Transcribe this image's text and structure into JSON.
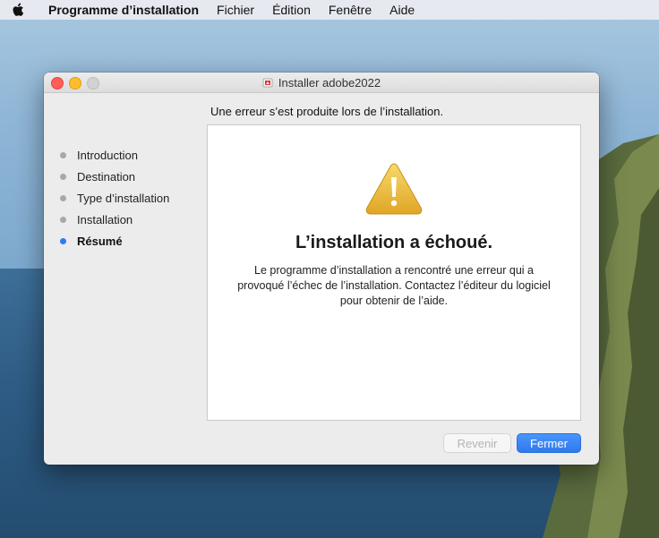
{
  "menubar": {
    "apple_icon": "apple-logo-icon",
    "app_name": "Programme d’installation",
    "items": [
      "Fichier",
      "Édition",
      "Fenêtre",
      "Aide"
    ]
  },
  "window": {
    "title": "Installer adobe2022",
    "title_icon": "package-icon",
    "heading": "Une erreur s’est produite lors de l’installation.",
    "steps": [
      {
        "label": "Introduction",
        "active": false
      },
      {
        "label": "Destination",
        "active": false
      },
      {
        "label": "Type d’installation",
        "active": false
      },
      {
        "label": "Installation",
        "active": false
      },
      {
        "label": "Résumé",
        "active": true
      }
    ],
    "panel": {
      "icon": "warning-triangle-icon",
      "title": "L’installation a échoué.",
      "message": "Le programme d’installation a rencontré une erreur qui a provoqué l’échec de l’installation. Contactez l’éditeur du logiciel pour obtenir de l’aide."
    },
    "buttons": {
      "back": "Revenir",
      "close": "Fermer"
    }
  },
  "colors": {
    "accent": "#2f7bf5",
    "warning": "#f2c232"
  }
}
